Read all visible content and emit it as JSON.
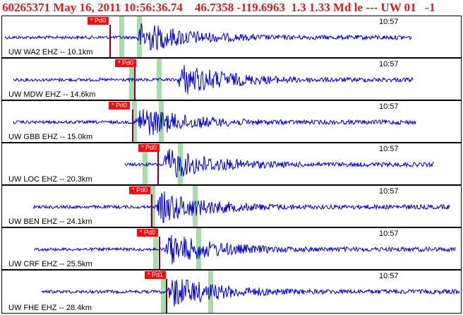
{
  "header": {
    "event_id": "60265371",
    "date": "May 16, 2011",
    "time": "10:56:36.74",
    "latitude": "46.7358",
    "longitude": "-119.6963",
    "mag_info": "1.3 1.33 Md le ---",
    "network_info": "UW 01   -1"
  },
  "colors": {
    "title": "#d81e1e",
    "waveform": "#0000cc",
    "pick_bar": "#ee1111",
    "pick_line": "#7a003a",
    "window_band": "#a8dca8"
  },
  "channels": [
    {
      "station_label": "UW WA2 EHZ -- 10.1km",
      "time_label": "10:57",
      "pick_label": "* Pd0"
    },
    {
      "station_label": "UW MDW EHZ -- 14.6km",
      "time_label": "10:57",
      "pick_label": "* Pd0"
    },
    {
      "station_label": "UW GBB EHZ -- 15.0km",
      "time_label": "10:57",
      "pick_label": "* Pd0"
    },
    {
      "station_label": "UW LOC EHZ -- 20.3km",
      "time_label": "10:57",
      "pick_label": "* Pd0"
    },
    {
      "station_label": "UW BEN EHZ -- 24.1km",
      "time_label": "10:57",
      "pick_label": "* Pd0"
    },
    {
      "station_label": "UW CRF EHZ -- 25.5km",
      "time_label": "10:57",
      "pick_label": "* Pd0"
    },
    {
      "station_label": "UW FHE EHZ -- 28.4km",
      "time_label": "10:57",
      "pick_label": "* Pd1"
    }
  ]
}
